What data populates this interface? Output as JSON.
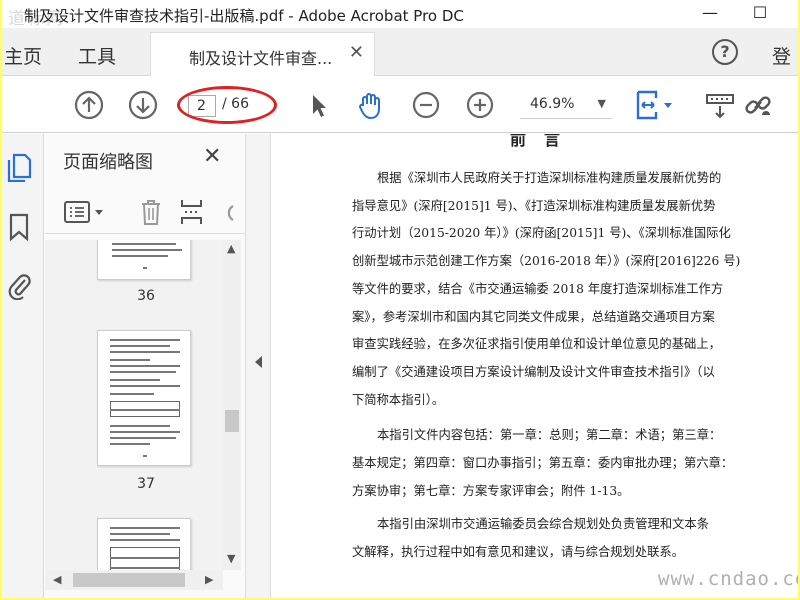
{
  "window": {
    "logo_text": "道标网",
    "title": "制及设计文件审查技术指引-出版稿.pdf - Adobe Acrobat Pro DC",
    "minimize": "—",
    "maximize": "☐"
  },
  "tabs": {
    "home": "主页",
    "tools": "工具",
    "document": "制及设计文件审查...",
    "login": "登"
  },
  "toolbar": {
    "current_page": "2",
    "total_pages": "/ 66",
    "zoom": "46.9%"
  },
  "panel": {
    "title": "页面缩略图",
    "thumbnails": [
      {
        "page": "36"
      },
      {
        "page": "37"
      }
    ]
  },
  "document": {
    "heading": "前言",
    "lines": [
      "根据《深圳市人民政府关于打造深圳标准构建质量发展新优势的",
      "指导意见》(深府[2015]1 号)、《打造深圳标准构建质量发展新优势",
      "行动计划（2015-2020 年）》(深府函[2015]1 号)、《深圳标准国际化",
      "创新型城市示范创建工作方案（2016-2018 年）》(深府[2016]226 号)",
      "等文件的要求，结合《市交通运输委 2018 年度打造深圳标准工作方",
      "案》，参考深圳市和国内其它同类文件成果，总结道路交通项目方案",
      "审查实践经验，在多次征求指引使用单位和设计单位意见的基础上，",
      "编制了《交通建设项目方案设计编制及设计文件审查技术指引》（以",
      "下简称本指引）。",
      "本指引文件内容包括：第一章：总则；第二章：术语；第三章：",
      "基本规定；第四章：窗口办事指引；第五章：委内审批办理；第六章：",
      "方案协审；第七章：方案专家评审会；附件 1-13。",
      "本指引由深圳市交通运输委员会综合规划处负责管理和文本条",
      "文解释，执行过程中如有意见和建议，请与综合规划处联系。"
    ],
    "watermark": "www.cndao.com"
  },
  "colors": {
    "accent_blue": "#2a6fd6",
    "annotation_red": "#e02020",
    "page_border": "#ffff60"
  }
}
